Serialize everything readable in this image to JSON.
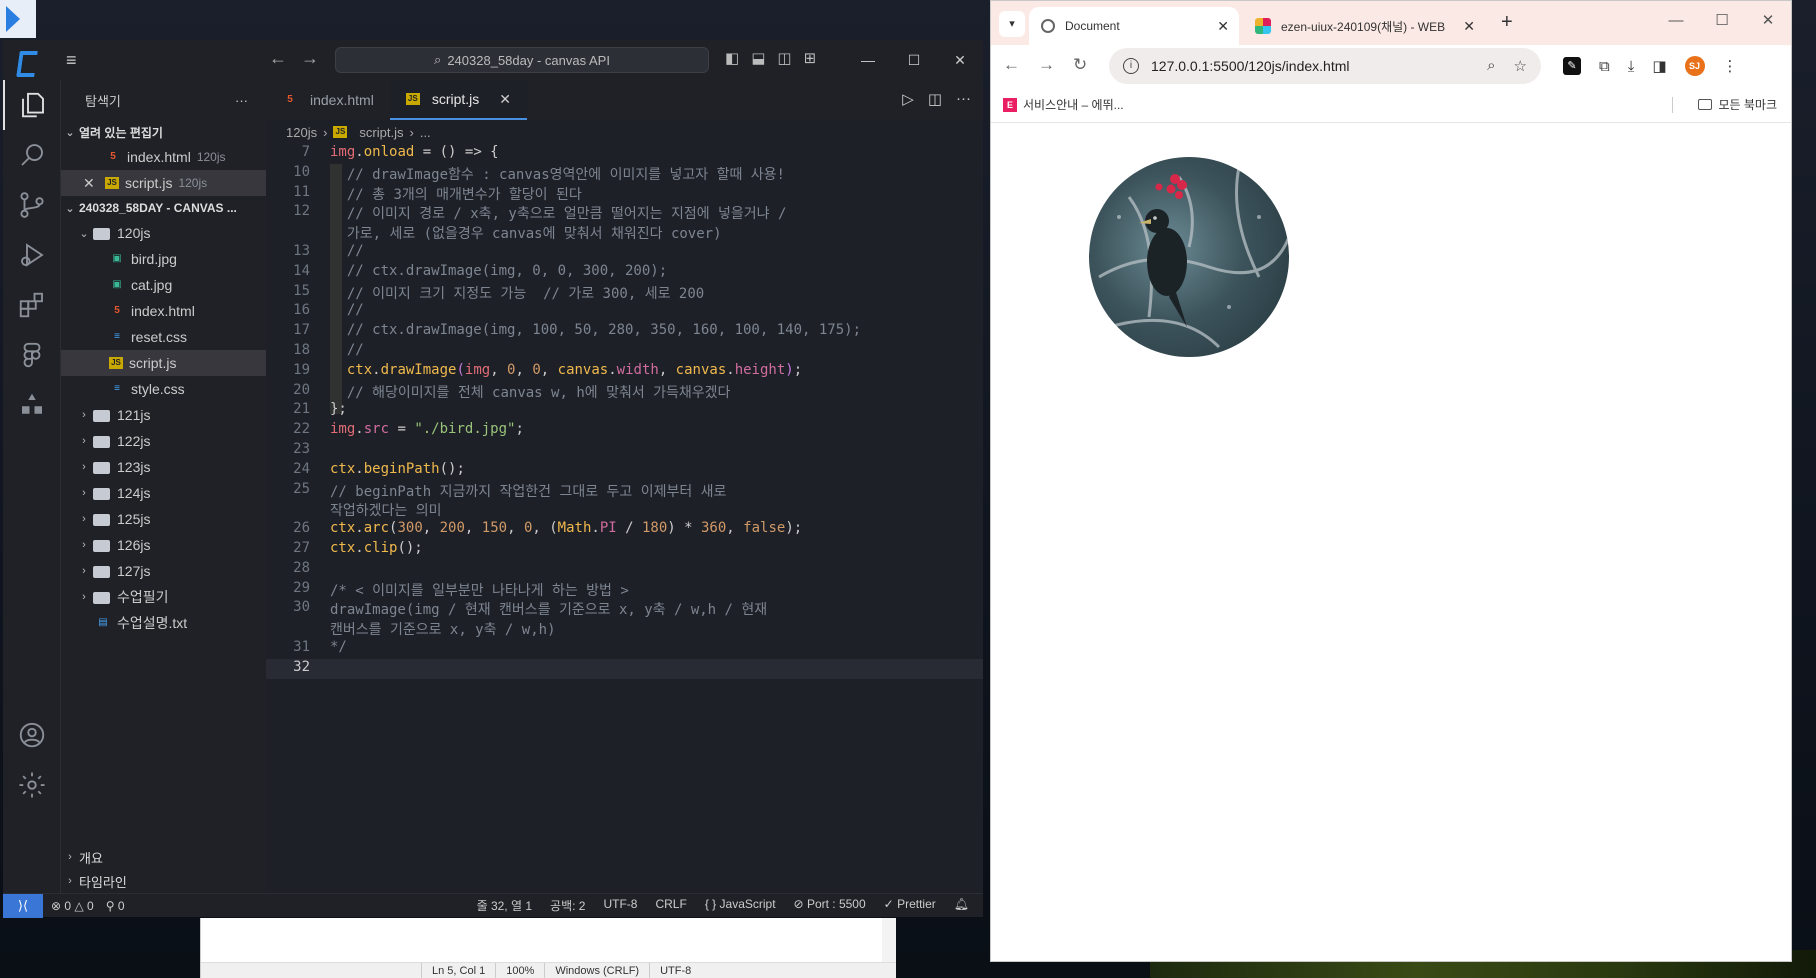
{
  "vscode": {
    "search_title": "240328_58day - canvas API",
    "explorer_title": "탐색기",
    "open_editors_label": "열려 있는 편집기",
    "open_editors": [
      {
        "name": "index.html",
        "folder": "120js",
        "type": "html",
        "closeable": false
      },
      {
        "name": "script.js",
        "folder": "120js",
        "type": "js",
        "closeable": true
      }
    ],
    "workspace_label": "240328_58DAY - CANVAS ...",
    "tree": [
      {
        "name": "120js",
        "kind": "folder",
        "open": true
      },
      {
        "name": "bird.jpg",
        "kind": "img"
      },
      {
        "name": "cat.jpg",
        "kind": "img"
      },
      {
        "name": "index.html",
        "kind": "html"
      },
      {
        "name": "reset.css",
        "kind": "css"
      },
      {
        "name": "script.js",
        "kind": "js"
      },
      {
        "name": "style.css",
        "kind": "css"
      },
      {
        "name": "121js",
        "kind": "folder"
      },
      {
        "name": "122js",
        "kind": "folder"
      },
      {
        "name": "123js",
        "kind": "folder"
      },
      {
        "name": "124js",
        "kind": "folder"
      },
      {
        "name": "125js",
        "kind": "folder"
      },
      {
        "name": "126js",
        "kind": "folder"
      },
      {
        "name": "127js",
        "kind": "folder"
      },
      {
        "name": "수업필기",
        "kind": "folder"
      },
      {
        "name": "수업설명.txt",
        "kind": "txt"
      }
    ],
    "outline_label": "개요",
    "timeline_label": "타임라인",
    "tabs": [
      {
        "label": "index.html",
        "type": "html"
      },
      {
        "label": "script.js",
        "type": "js"
      }
    ],
    "breadcrumb": [
      "120js",
      "script.js",
      "..."
    ],
    "code_lines": [
      {
        "n": "7",
        "tokens": [
          [
            "var",
            "img"
          ],
          [
            "op",
            "."
          ],
          [
            "fn",
            "onload"
          ],
          [
            "op",
            " = () => {"
          ]
        ]
      },
      {
        "n": "10",
        "tokens": [
          [
            "cm",
            "  // drawImage함수 : canvas영역안에 이미지를 넣고자 할때 사용!"
          ]
        ]
      },
      {
        "n": "11",
        "tokens": [
          [
            "cm",
            "  // 총 3개의 매개변수가 할당이 된다"
          ]
        ]
      },
      {
        "n": "12",
        "tokens": [
          [
            "cm",
            "  // 이미지 경로 / x축, y축으로 얼만큼 떨어지는 지점에 넣을거냐 /"
          ]
        ]
      },
      {
        "n": "",
        "tokens": [
          [
            "cm",
            "  가로, 세로 (없을경우 canvas에 맞춰서 채워진다 cover)"
          ]
        ]
      },
      {
        "n": "13",
        "tokens": [
          [
            "cm",
            "  //"
          ]
        ]
      },
      {
        "n": "14",
        "tokens": [
          [
            "cm",
            "  // ctx.drawImage(img, 0, 0, 300, 200);"
          ]
        ]
      },
      {
        "n": "15",
        "tokens": [
          [
            "cm",
            "  // 이미지 크기 지정도 가능  // 가로 300, 세로 200"
          ]
        ]
      },
      {
        "n": "16",
        "tokens": [
          [
            "cm",
            "  //"
          ]
        ]
      },
      {
        "n": "17",
        "tokens": [
          [
            "cm",
            "  // ctx.drawImage(img, 100, 50, 280, 350, 160, 100, 140, 175);"
          ]
        ]
      },
      {
        "n": "18",
        "tokens": [
          [
            "cm",
            "  //"
          ]
        ]
      },
      {
        "n": "19",
        "tokens": [
          [
            "op",
            "  "
          ],
          [
            "fn",
            "ctx"
          ],
          [
            "op",
            "."
          ],
          [
            "fn",
            "drawImage"
          ],
          [
            "kw",
            "("
          ],
          [
            "var",
            "img"
          ],
          [
            "op",
            ", "
          ],
          [
            "num",
            "0"
          ],
          [
            "op",
            ", "
          ],
          [
            "num",
            "0"
          ],
          [
            "op",
            ", "
          ],
          [
            "fn",
            "canvas"
          ],
          [
            "op",
            "."
          ],
          [
            "prop",
            "width"
          ],
          [
            "op",
            ", "
          ],
          [
            "fn",
            "canvas"
          ],
          [
            "op",
            "."
          ],
          [
            "prop",
            "height"
          ],
          [
            "kw",
            ")"
          ],
          [
            "op",
            ";"
          ]
        ]
      },
      {
        "n": "20",
        "tokens": [
          [
            "cm",
            "  // 해당이미지를 전체 canvas w, h에 맞춰서 가득채우겠다"
          ]
        ]
      },
      {
        "n": "21",
        "tokens": [
          [
            "op",
            "};"
          ]
        ]
      },
      {
        "n": "22",
        "tokens": [
          [
            "var",
            "img"
          ],
          [
            "op",
            "."
          ],
          [
            "prop",
            "src"
          ],
          [
            "op",
            " = "
          ],
          [
            "str",
            "\"./bird.jpg\""
          ],
          [
            "op",
            ";"
          ]
        ]
      },
      {
        "n": "23",
        "tokens": []
      },
      {
        "n": "24",
        "tokens": [
          [
            "fn",
            "ctx"
          ],
          [
            "op",
            "."
          ],
          [
            "fn",
            "beginPath"
          ],
          [
            "op",
            "();"
          ]
        ]
      },
      {
        "n": "25",
        "tokens": [
          [
            "cm",
            "// beginPath 지금까지 작업한건 그대로 두고 이제부터 새로"
          ]
        ]
      },
      {
        "n": "",
        "tokens": [
          [
            "cm",
            "작업하겠다는 의미"
          ]
        ]
      },
      {
        "n": "26",
        "tokens": [
          [
            "fn",
            "ctx"
          ],
          [
            "op",
            "."
          ],
          [
            "fn",
            "arc"
          ],
          [
            "op",
            "("
          ],
          [
            "num",
            "300"
          ],
          [
            "op",
            ", "
          ],
          [
            "num",
            "200"
          ],
          [
            "op",
            ", "
          ],
          [
            "num",
            "150"
          ],
          [
            "op",
            ", "
          ],
          [
            "num",
            "0"
          ],
          [
            "op",
            ", ("
          ],
          [
            "fn",
            "Math"
          ],
          [
            "op",
            "."
          ],
          [
            "prop",
            "PI"
          ],
          [
            "op",
            " / "
          ],
          [
            "num",
            "180"
          ],
          [
            "op",
            ") * "
          ],
          [
            "num",
            "360"
          ],
          [
            "op",
            ", "
          ],
          [
            "num",
            "false"
          ],
          [
            "op",
            ");"
          ]
        ]
      },
      {
        "n": "27",
        "tokens": [
          [
            "fn",
            "ctx"
          ],
          [
            "op",
            "."
          ],
          [
            "fn",
            "clip"
          ],
          [
            "op",
            "();"
          ]
        ]
      },
      {
        "n": "28",
        "tokens": []
      },
      {
        "n": "29",
        "tokens": [
          [
            "cm",
            "/* < 이미지를 일부분만 나타나게 하는 방법 >"
          ]
        ]
      },
      {
        "n": "30",
        "tokens": [
          [
            "cm",
            "drawImage(img / 현재 캔버스를 기준으로 x, y축 / w,h / 현재"
          ]
        ]
      },
      {
        "n": "",
        "tokens": [
          [
            "cm",
            "캔버스를 기준으로 x, y축 / w,h)"
          ]
        ]
      },
      {
        "n": "31",
        "tokens": [
          [
            "cm",
            "*/"
          ]
        ]
      },
      {
        "n": "32",
        "tokens": [],
        "current": true
      }
    ],
    "status": {
      "errors": "0",
      "warnings": "0",
      "ports": "0",
      "position": "줄 32, 열 1",
      "spaces": "공백: 2",
      "encoding": "UTF-8",
      "eol": "CRLF",
      "language": "JavaScript",
      "port": "Port : 5500",
      "prettier": "Prettier"
    }
  },
  "notepad": {
    "status": [
      "Ln 5, Col 1",
      "100%",
      "Windows (CRLF)",
      "UTF-8"
    ]
  },
  "chrome": {
    "tabs": [
      {
        "title": "Document",
        "active": true
      },
      {
        "title": "ezen-uiux-240109(채널) - WEB",
        "active": false
      }
    ],
    "url": "127.0.0.1:5500/120js/index.html",
    "bookmark": "서비스안내 – 에뛰...",
    "all_bookmarks": "모든 북마크",
    "avatar_initials": "SJ"
  }
}
